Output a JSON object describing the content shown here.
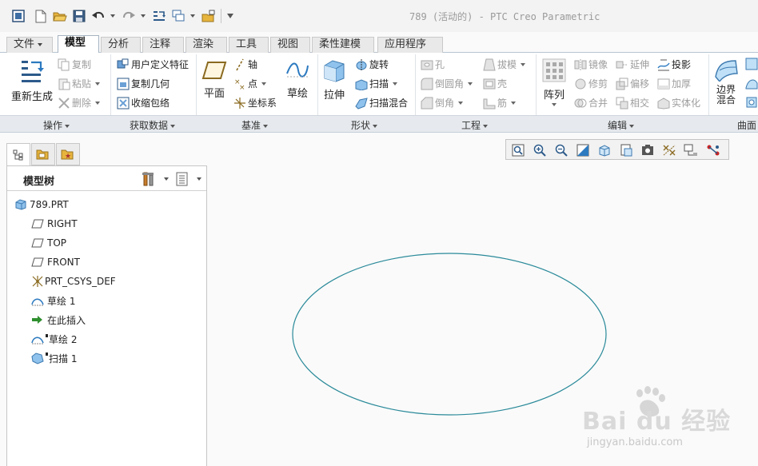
{
  "window": {
    "title": "789 (活动的) - PTC Creo Parametric"
  },
  "quick_access": [
    "app-menu-icon",
    "new-icon",
    "open-icon",
    "save-icon",
    "undo-icon",
    "redo-icon",
    "regenerate-icon",
    "windows-icon",
    "close-window-icon",
    "customize-icon"
  ],
  "tabs": [
    {
      "label": "文件",
      "dropdown": true
    },
    {
      "label": "模型",
      "active": true
    },
    {
      "label": "分析"
    },
    {
      "label": "注释"
    },
    {
      "label": "渲染"
    },
    {
      "label": "工具"
    },
    {
      "label": "视图"
    },
    {
      "label": "柔性建模"
    },
    {
      "label": "应用程序"
    }
  ],
  "ribbon": {
    "groups": {
      "operations": "操作",
      "get_data": "获取数据",
      "datum": "基准",
      "shapes": "形状",
      "engineering": "工程",
      "editing": "编辑",
      "surfaces": "曲面"
    },
    "operations": {
      "regenerate": "重新生成",
      "copy": "复制",
      "paste": "粘贴",
      "delete": "删除"
    },
    "get_data": {
      "udf": "用户定义特征",
      "copy_geom": "复制几何",
      "shrinkwrap": "收缩包络"
    },
    "datum": {
      "plane": "平面",
      "axis": "轴",
      "point": "点",
      "csys": "坐标系",
      "sketch": "草绘"
    },
    "shapes": {
      "extrude": "拉伸",
      "revolve": "旋转",
      "sweep": "扫描",
      "swept_blend": "扫描混合"
    },
    "engineering": {
      "hole": "孔",
      "round": "倒圆角",
      "chamfer": "倒角",
      "draft": "拔模",
      "shell": "壳",
      "rib": "筋"
    },
    "editing": {
      "pattern": "阵列",
      "mirror": "镜像",
      "trim": "修剪",
      "merge": "合并",
      "extend": "延伸",
      "offset": "偏移",
      "intersect": "相交",
      "project": "投影",
      "thicken": "加厚",
      "solidify": "实体化"
    },
    "surfaces": {
      "boundary_blend_1": "边界",
      "boundary_blend_2": "混合"
    }
  },
  "model_tree": {
    "title": "模型树",
    "items": [
      {
        "label": "789.PRT",
        "icon": "part-icon"
      },
      {
        "label": "RIGHT",
        "icon": "datum-plane-icon"
      },
      {
        "label": "TOP",
        "icon": "datum-plane-icon"
      },
      {
        "label": "FRONT",
        "icon": "datum-plane-icon"
      },
      {
        "label": "PRT_CSYS_DEF",
        "icon": "csys-icon"
      },
      {
        "label": "草绘 1",
        "icon": "sketch-icon"
      },
      {
        "label": "在此插入",
        "icon": "insert-here-arrow-icon"
      },
      {
        "label": "草绘 2",
        "icon": "sketch-icon"
      },
      {
        "label": "扫描 1",
        "icon": "sweep-icon"
      }
    ]
  },
  "graphics_toolbar": [
    "refit-icon",
    "zoom-in-icon",
    "zoom-out-icon",
    "repaint-icon",
    "display-style-icon",
    "saved-orientations-icon",
    "view-manager-icon",
    "datum-display-icon",
    "spin-center-icon",
    "annotation-display-icon"
  ],
  "watermark": {
    "brand_text": "Bai du 经验",
    "url": "jingyan.baidu.com"
  },
  "colors": {
    "curve": "#2a8a9a",
    "tab_border": "#a6b4c2",
    "group_bar": "#e6eaee"
  }
}
